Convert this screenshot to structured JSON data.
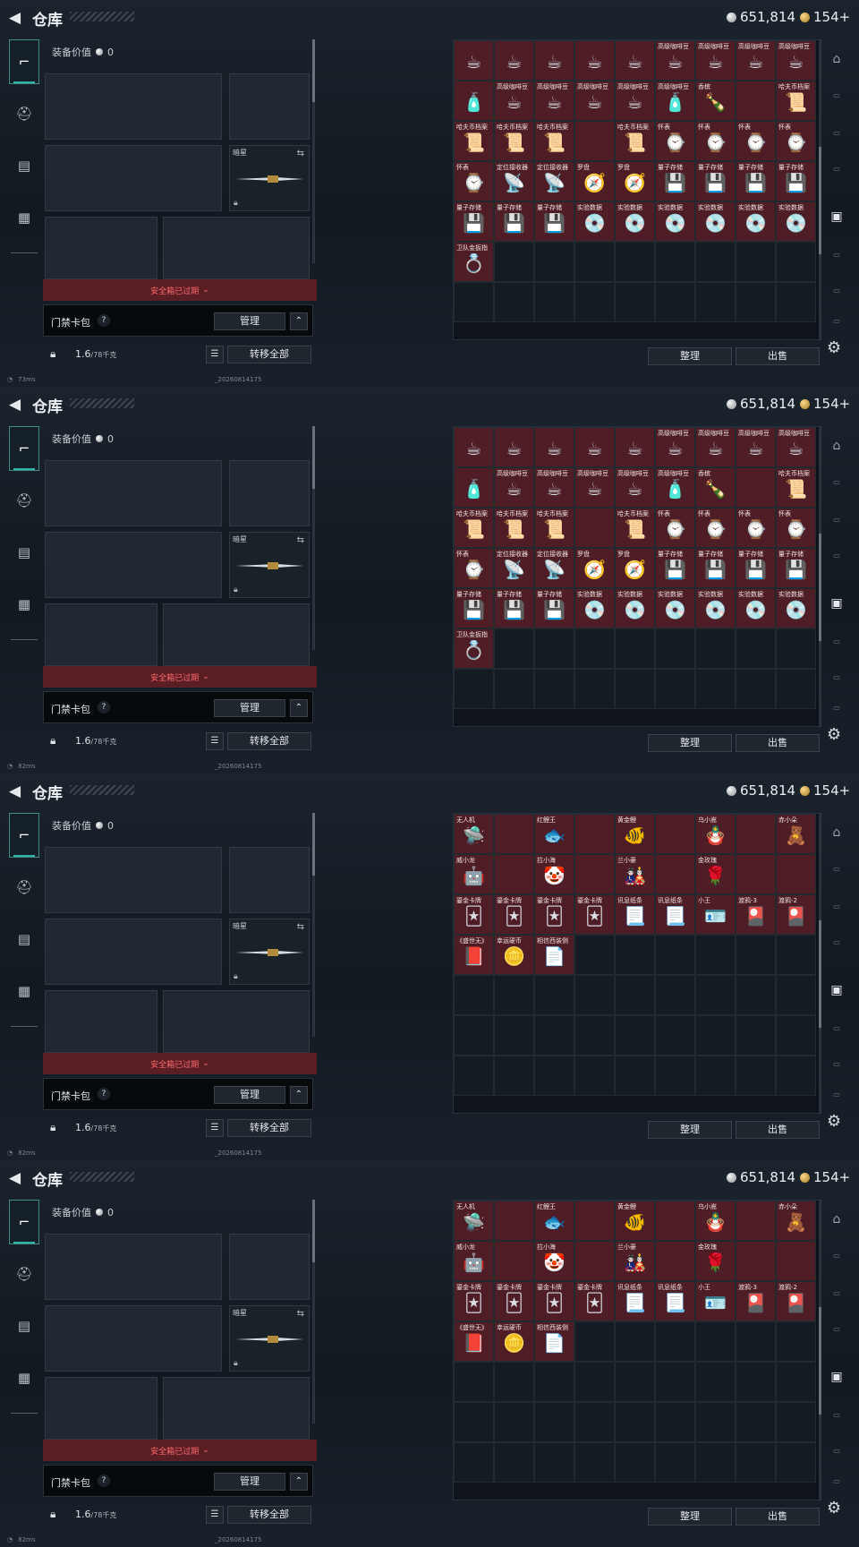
{
  "colors": {
    "accent": "#2fb3a4",
    "item_bg": "#4e1d25",
    "alert": "#ff6b6b"
  },
  "panels": [
    {
      "header": {
        "back_icon": "back-arrow-icon",
        "title": "仓库",
        "silver": "651,814",
        "gold": "154+"
      },
      "equipment": {
        "value_label": "装备价值",
        "value": "0",
        "melee_label": "暗星"
      },
      "safebox": {
        "label": "安全箱已过期"
      },
      "keycard": {
        "label": "门禁卡包",
        "help": "?",
        "manage": "管理"
      },
      "capacity": {
        "weight": "1.6",
        "max": "/78千克",
        "transfer": "转移全部"
      },
      "footer": {
        "latency": "73ms",
        "build": "_20260814175"
      },
      "actions": {
        "sort": "整理",
        "sell": "出售"
      },
      "items": [
        {
          "name": "",
          "icon": "☕"
        },
        {
          "name": "",
          "icon": "☕"
        },
        {
          "name": "",
          "icon": "☕"
        },
        {
          "name": "",
          "icon": "☕"
        },
        {
          "name": "",
          "icon": "☕"
        },
        {
          "name": "高级咖啡豆",
          "icon": "☕"
        },
        {
          "name": "高级咖啡豆",
          "icon": "☕"
        },
        {
          "name": "高级咖啡豆",
          "icon": "☕"
        },
        {
          "name": "高级咖啡豆",
          "icon": "☕"
        },
        {
          "name": "",
          "icon": "🧴"
        },
        {
          "name": "高级咖啡豆",
          "icon": "☕"
        },
        {
          "name": "高级咖啡豆",
          "icon": "☕"
        },
        {
          "name": "高级咖啡豆",
          "icon": "☕"
        },
        {
          "name": "高级咖啡豆",
          "icon": "☕"
        },
        {
          "name": "高级咖啡豆",
          "icon": "🧴"
        },
        {
          "name": "香槟",
          "icon": "🍾"
        },
        {
          "name": "",
          "icon": ""
        },
        {
          "name": "哈夫币档案",
          "icon": "📜"
        },
        {
          "name": "哈夫币档案",
          "icon": "📜"
        },
        {
          "name": "哈夫币档案",
          "icon": "📜"
        },
        {
          "name": "哈夫币档案",
          "icon": "📜"
        },
        {
          "name": "",
          "icon": ""
        },
        {
          "name": "哈夫币档案",
          "icon": "📜"
        },
        {
          "name": "怀表",
          "icon": "⌚"
        },
        {
          "name": "怀表",
          "icon": "⌚"
        },
        {
          "name": "怀表",
          "icon": "⌚"
        },
        {
          "name": "怀表",
          "icon": "⌚"
        },
        {
          "name": "怀表",
          "icon": "⌚"
        },
        {
          "name": "定位接收器",
          "icon": "📡"
        },
        {
          "name": "定位接收器",
          "icon": "📡"
        },
        {
          "name": "罗盘",
          "icon": "🧭"
        },
        {
          "name": "罗盘",
          "icon": "🧭"
        },
        {
          "name": "量子存储",
          "icon": "💾"
        },
        {
          "name": "量子存储",
          "icon": "💾"
        },
        {
          "name": "量子存储",
          "icon": "💾"
        },
        {
          "name": "量子存储",
          "icon": "💾"
        },
        {
          "name": "量子存储",
          "icon": "💾"
        },
        {
          "name": "量子存储",
          "icon": "💾"
        },
        {
          "name": "量子存储",
          "icon": "💾"
        },
        {
          "name": "实验数据",
          "icon": "💿"
        },
        {
          "name": "实验数据",
          "icon": "💿"
        },
        {
          "name": "实验数据",
          "icon": "💿"
        },
        {
          "name": "实验数据",
          "icon": "💿"
        },
        {
          "name": "实验数据",
          "icon": "💿"
        },
        {
          "name": "实验数据",
          "icon": "💿"
        },
        {
          "name": "卫队金扳指",
          "icon": "💍"
        }
      ]
    },
    {
      "header": {
        "back_icon": "back-arrow-icon",
        "title": "仓库",
        "silver": "651,814",
        "gold": "154+"
      },
      "equipment": {
        "value_label": "装备价值",
        "value": "0",
        "melee_label": "暗星"
      },
      "safebox": {
        "label": "安全箱已过期"
      },
      "keycard": {
        "label": "门禁卡包",
        "help": "?",
        "manage": "管理"
      },
      "capacity": {
        "weight": "1.6",
        "max": "/78千克",
        "transfer": "转移全部"
      },
      "footer": {
        "latency": "82ms",
        "build": "_20260814175"
      },
      "actions": {
        "sort": "整理",
        "sell": "出售"
      },
      "items": [
        {
          "name": "",
          "icon": "☕"
        },
        {
          "name": "",
          "icon": "☕"
        },
        {
          "name": "",
          "icon": "☕"
        },
        {
          "name": "",
          "icon": "☕"
        },
        {
          "name": "",
          "icon": "☕"
        },
        {
          "name": "高级咖啡豆",
          "icon": "☕"
        },
        {
          "name": "高级咖啡豆",
          "icon": "☕"
        },
        {
          "name": "高级咖啡豆",
          "icon": "☕"
        },
        {
          "name": "高级咖啡豆",
          "icon": "☕"
        },
        {
          "name": "",
          "icon": "🧴"
        },
        {
          "name": "高级咖啡豆",
          "icon": "☕"
        },
        {
          "name": "高级咖啡豆",
          "icon": "☕"
        },
        {
          "name": "高级咖啡豆",
          "icon": "☕"
        },
        {
          "name": "高级咖啡豆",
          "icon": "☕"
        },
        {
          "name": "高级咖啡豆",
          "icon": "🧴"
        },
        {
          "name": "香槟",
          "icon": "🍾"
        },
        {
          "name": "",
          "icon": ""
        },
        {
          "name": "哈夫币档案",
          "icon": "📜"
        },
        {
          "name": "哈夫币档案",
          "icon": "📜"
        },
        {
          "name": "哈夫币档案",
          "icon": "📜"
        },
        {
          "name": "哈夫币档案",
          "icon": "📜"
        },
        {
          "name": "",
          "icon": ""
        },
        {
          "name": "哈夫币档案",
          "icon": "📜"
        },
        {
          "name": "怀表",
          "icon": "⌚"
        },
        {
          "name": "怀表",
          "icon": "⌚"
        },
        {
          "name": "怀表",
          "icon": "⌚"
        },
        {
          "name": "怀表",
          "icon": "⌚"
        },
        {
          "name": "怀表",
          "icon": "⌚"
        },
        {
          "name": "定位接收器",
          "icon": "📡"
        },
        {
          "name": "定位接收器",
          "icon": "📡"
        },
        {
          "name": "罗盘",
          "icon": "🧭"
        },
        {
          "name": "罗盘",
          "icon": "🧭"
        },
        {
          "name": "量子存储",
          "icon": "💾"
        },
        {
          "name": "量子存储",
          "icon": "💾"
        },
        {
          "name": "量子存储",
          "icon": "💾"
        },
        {
          "name": "量子存储",
          "icon": "💾"
        },
        {
          "name": "量子存储",
          "icon": "💾"
        },
        {
          "name": "量子存储",
          "icon": "💾"
        },
        {
          "name": "量子存储",
          "icon": "💾"
        },
        {
          "name": "实验数据",
          "icon": "💿"
        },
        {
          "name": "实验数据",
          "icon": "💿"
        },
        {
          "name": "实验数据",
          "icon": "💿"
        },
        {
          "name": "实验数据",
          "icon": "💿"
        },
        {
          "name": "实验数据",
          "icon": "💿"
        },
        {
          "name": "实验数据",
          "icon": "💿"
        },
        {
          "name": "卫队金扳指",
          "icon": "💍"
        }
      ]
    },
    {
      "header": {
        "back_icon": "back-arrow-icon",
        "title": "仓库",
        "silver": "651,814",
        "gold": "154+"
      },
      "equipment": {
        "value_label": "装备价值",
        "value": "0",
        "melee_label": "暗星"
      },
      "safebox": {
        "label": "安全箱已过期"
      },
      "keycard": {
        "label": "门禁卡包",
        "help": "?",
        "manage": "管理"
      },
      "capacity": {
        "weight": "1.6",
        "max": "/78千克",
        "transfer": "转移全部"
      },
      "footer": {
        "latency": "82ms",
        "build": "_20260814175"
      },
      "actions": {
        "sort": "整理",
        "sell": "出售"
      },
      "items": [
        {
          "name": "无人机",
          "icon": "🛸"
        },
        {
          "name": "",
          "icon": ""
        },
        {
          "name": "红鲤王",
          "icon": "🐟"
        },
        {
          "name": "",
          "icon": ""
        },
        {
          "name": "黄金鲤",
          "icon": "🐠"
        },
        {
          "name": "",
          "icon": ""
        },
        {
          "name": "乌小嵩",
          "icon": "🪆"
        },
        {
          "name": "",
          "icon": ""
        },
        {
          "name": "赤小朵",
          "icon": "🧸"
        },
        {
          "name": "威小龙",
          "icon": "🤖"
        },
        {
          "name": "",
          "icon": ""
        },
        {
          "name": "拉小海",
          "icon": "🤡"
        },
        {
          "name": "",
          "icon": ""
        },
        {
          "name": "兰小豪",
          "icon": "🎎"
        },
        {
          "name": "",
          "icon": ""
        },
        {
          "name": "金玫瑰",
          "icon": "🌹"
        },
        {
          "name": "",
          "icon": ""
        },
        {
          "name": "",
          "icon": ""
        },
        {
          "name": "鎏金卡牌",
          "icon": "🃏"
        },
        {
          "name": "鎏金卡牌",
          "icon": "🃏"
        },
        {
          "name": "鎏金卡牌",
          "icon": "🃏"
        },
        {
          "name": "鎏金卡牌",
          "icon": "🃏"
        },
        {
          "name": "讯息纸条",
          "icon": "📃"
        },
        {
          "name": "讯息纸条",
          "icon": "📃"
        },
        {
          "name": "小王",
          "icon": "🪪"
        },
        {
          "name": "渡鸦-3",
          "icon": "🎴"
        },
        {
          "name": "渡鸦-2",
          "icon": "🎴"
        },
        {
          "name": "《盛世无》",
          "icon": "📕"
        },
        {
          "name": "幸运硬币",
          "icon": "🪙"
        },
        {
          "name": "相信西装侧",
          "icon": "📄"
        }
      ]
    },
    {
      "header": {
        "back_icon": "back-arrow-icon",
        "title": "仓库",
        "silver": "651,814",
        "gold": "154+"
      },
      "equipment": {
        "value_label": "装备价值",
        "value": "0",
        "melee_label": "暗星"
      },
      "safebox": {
        "label": "安全箱已过期"
      },
      "keycard": {
        "label": "门禁卡包",
        "help": "?",
        "manage": "管理"
      },
      "capacity": {
        "weight": "1.6",
        "max": "/78千克",
        "transfer": "转移全部"
      },
      "footer": {
        "latency": "82ms",
        "build": "_20260814175"
      },
      "actions": {
        "sort": "整理",
        "sell": "出售"
      },
      "items": [
        {
          "name": "无人机",
          "icon": "🛸"
        },
        {
          "name": "",
          "icon": ""
        },
        {
          "name": "红鲤王",
          "icon": "🐟"
        },
        {
          "name": "",
          "icon": ""
        },
        {
          "name": "黄金鲤",
          "icon": "🐠"
        },
        {
          "name": "",
          "icon": ""
        },
        {
          "name": "乌小嵩",
          "icon": "🪆"
        },
        {
          "name": "",
          "icon": ""
        },
        {
          "name": "赤小朵",
          "icon": "🧸"
        },
        {
          "name": "威小龙",
          "icon": "🤖"
        },
        {
          "name": "",
          "icon": ""
        },
        {
          "name": "拉小海",
          "icon": "🤡"
        },
        {
          "name": "",
          "icon": ""
        },
        {
          "name": "兰小豪",
          "icon": "🎎"
        },
        {
          "name": "",
          "icon": ""
        },
        {
          "name": "金玫瑰",
          "icon": "🌹"
        },
        {
          "name": "",
          "icon": ""
        },
        {
          "name": "",
          "icon": ""
        },
        {
          "name": "鎏金卡牌",
          "icon": "🃏"
        },
        {
          "name": "鎏金卡牌",
          "icon": "🃏"
        },
        {
          "name": "鎏金卡牌",
          "icon": "🃏"
        },
        {
          "name": "鎏金卡牌",
          "icon": "🃏"
        },
        {
          "name": "讯息纸条",
          "icon": "📃"
        },
        {
          "name": "讯息纸条",
          "icon": "📃"
        },
        {
          "name": "小王",
          "icon": "🪪"
        },
        {
          "name": "渡鸦-3",
          "icon": "🎴"
        },
        {
          "name": "渡鸦-2",
          "icon": "🎴"
        },
        {
          "name": "《盛世无》",
          "icon": "📕"
        },
        {
          "name": "幸运硬币",
          "icon": "🪙"
        },
        {
          "name": "相信西装侧",
          "icon": "📄"
        }
      ]
    }
  ]
}
